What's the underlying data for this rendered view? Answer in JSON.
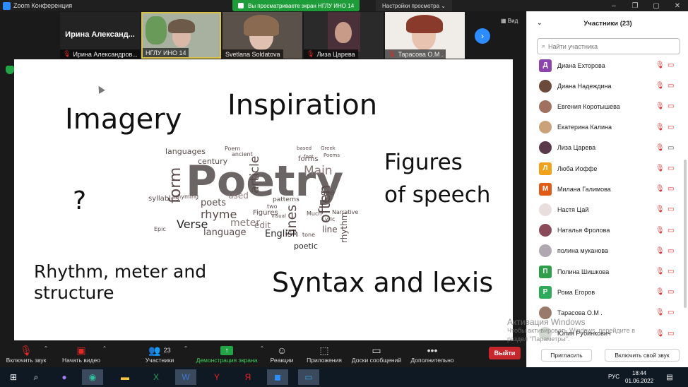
{
  "window": {
    "title": "Zoom Конференция",
    "share_banner": "Вы просматриваете экран НГЛУ ИНО 14",
    "view_options": "Настройки просмотра ⌄",
    "view_button": "Вид"
  },
  "video_strip": {
    "tiles": [
      {
        "big_name": "Ирина Александ...",
        "name": "Ирина Александров...",
        "muted": true
      },
      {
        "name": "НГЛУ ИНО 14",
        "muted": false
      },
      {
        "name": "Svetlana Soldatova",
        "muted": false
      },
      {
        "name": "Лиза Царева",
        "muted": true
      },
      {
        "name": "Тарасова О.М .",
        "muted": true
      }
    ]
  },
  "slide": {
    "words": {
      "imagery": "Imagery",
      "inspiration": "Inspiration",
      "figures1": "Figures",
      "figures2": "of speech",
      "question": "?",
      "rhythm1": "Rhythm, meter and",
      "rhythm2": "structure",
      "syntax": "Syntax and lexis"
    },
    "cloud": {
      "main": "Poetry",
      "words": [
        "languages",
        "form",
        "poets",
        "rhyme",
        "Verse",
        "language",
        "meter",
        "article",
        "often",
        "lines",
        "poetic",
        "rhythm",
        "English",
        "edit",
        "Main",
        "forms",
        "use",
        "line",
        "used",
        "Figures",
        "two",
        "rhyming",
        "Epic",
        "syllables",
        "ancient",
        "century",
        "Poem",
        "Lyric",
        "patterns",
        "tone",
        "based",
        "Greek",
        "foot",
        "Poems",
        "Visual",
        "Much",
        "Narrative",
        "Metrical",
        "Chinese",
        "culture",
        "first"
      ]
    }
  },
  "toolbar": {
    "mute": "Включить звук",
    "video": "Начать видео",
    "participants": "Участники",
    "participants_count": "23",
    "share": "Демонстрация экрана",
    "reactions": "Реакции",
    "apps": "Приложения",
    "chat": "Доски сообщений",
    "more": "Дополнительно",
    "leave": "Выйти"
  },
  "panel": {
    "title": "Участники (23)",
    "search_placeholder": "Найти участника",
    "participants": [
      {
        "name": "Диана Ехторова",
        "initial": "Д",
        "color": "#8e44ad",
        "muted": true,
        "video_off": true
      },
      {
        "name": "Диана Надеждина",
        "initial": "",
        "color": "#6b4a3a",
        "muted": true,
        "video_off": true
      },
      {
        "name": "Евгения Коротышева",
        "initial": "",
        "color": "#a07060",
        "muted": true,
        "video_off": true
      },
      {
        "name": "Екатерина Калина",
        "initial": "",
        "color": "#c9a27a",
        "muted": true,
        "video_off": true
      },
      {
        "name": "Лиза Царева",
        "initial": "",
        "color": "#5a3a4a",
        "muted": true,
        "video_off": false
      },
      {
        "name": "Люба Иоффе",
        "initial": "Л",
        "color": "#f0a21b",
        "muted": true,
        "video_off": true
      },
      {
        "name": "Милана Галимова",
        "initial": "М",
        "color": "#e05a1a",
        "muted": true,
        "video_off": true
      },
      {
        "name": "Настя Цай",
        "initial": "",
        "color": "#e8dede",
        "muted": true,
        "video_off": true
      },
      {
        "name": "Наталья Фролова",
        "initial": "",
        "color": "#8a4a5a",
        "muted": true,
        "video_off": true
      },
      {
        "name": "полина муканова",
        "initial": "",
        "color": "#b0a8b0",
        "muted": true,
        "video_off": true
      },
      {
        "name": "Полина Шишкова",
        "initial": "П",
        "color": "#2e9e4a",
        "muted": true,
        "video_off": true
      },
      {
        "name": "Рома Егоров",
        "initial": "Р",
        "color": "#2eaa5a",
        "muted": true,
        "video_off": true
      },
      {
        "name": "Тарасова О.М .",
        "initial": "",
        "color": "#9a7a6a",
        "muted": true,
        "video_off": true
      },
      {
        "name": "Юлия Рубинкович",
        "initial": "",
        "color": "#d0d8d0",
        "muted": true,
        "video_off": true
      }
    ],
    "invite": "Пригласить",
    "unmute_self": "Включить свой звук"
  },
  "watermark": {
    "line1": "Активация Windows",
    "line2": "Чтобы активировать Windows, перейдите в",
    "line3": "раздел \"Параметры\"."
  },
  "taskbar": {
    "lang": "РУС",
    "time": "18:44",
    "date": "01.06.2022"
  }
}
